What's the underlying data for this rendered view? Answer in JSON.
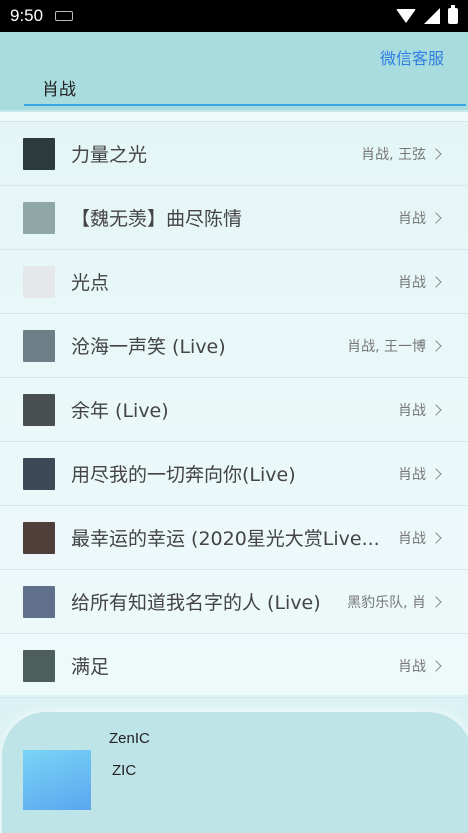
{
  "status_bar": {
    "time": "9:50",
    "icons": [
      "keyboard-icon",
      "wifi-icon",
      "signal-icon",
      "battery-icon"
    ]
  },
  "header": {
    "service_link": "微信客服",
    "search_value": "肖战"
  },
  "songs": [
    {
      "title": "力量之光",
      "artist": "肖战, 王弦",
      "cover_color": "#2b3a3c"
    },
    {
      "title": "【魏无羡】曲尽陈情",
      "artist": "肖战",
      "cover_color": "#8fa7a6"
    },
    {
      "title": "光点",
      "artist": "肖战",
      "cover_color": "#e5e8e8"
    },
    {
      "title": "沧海一声笑 (Live)",
      "artist": "肖战, 王一博",
      "cover_color": "#6c7f86"
    },
    {
      "title": "余年 (Live)",
      "artist": "肖战",
      "cover_color": "#4a4f4f"
    },
    {
      "title": "用尽我的一切奔向你(Live)",
      "artist": "肖战",
      "cover_color": "#3c4a58"
    },
    {
      "title": "最幸运的幸运 (2020星光大赏Live...",
      "artist": "肖战",
      "cover_color": "#503e3a"
    },
    {
      "title": "给所有知道我名字的人 (Live)",
      "artist": "黑豹乐队, 肖",
      "cover_color": "#5f6f8c"
    },
    {
      "title": "满足",
      "artist": "肖战",
      "cover_color": "#4d5f5a"
    }
  ],
  "player": {
    "title": "ZenIC",
    "artist": "ZIC"
  }
}
